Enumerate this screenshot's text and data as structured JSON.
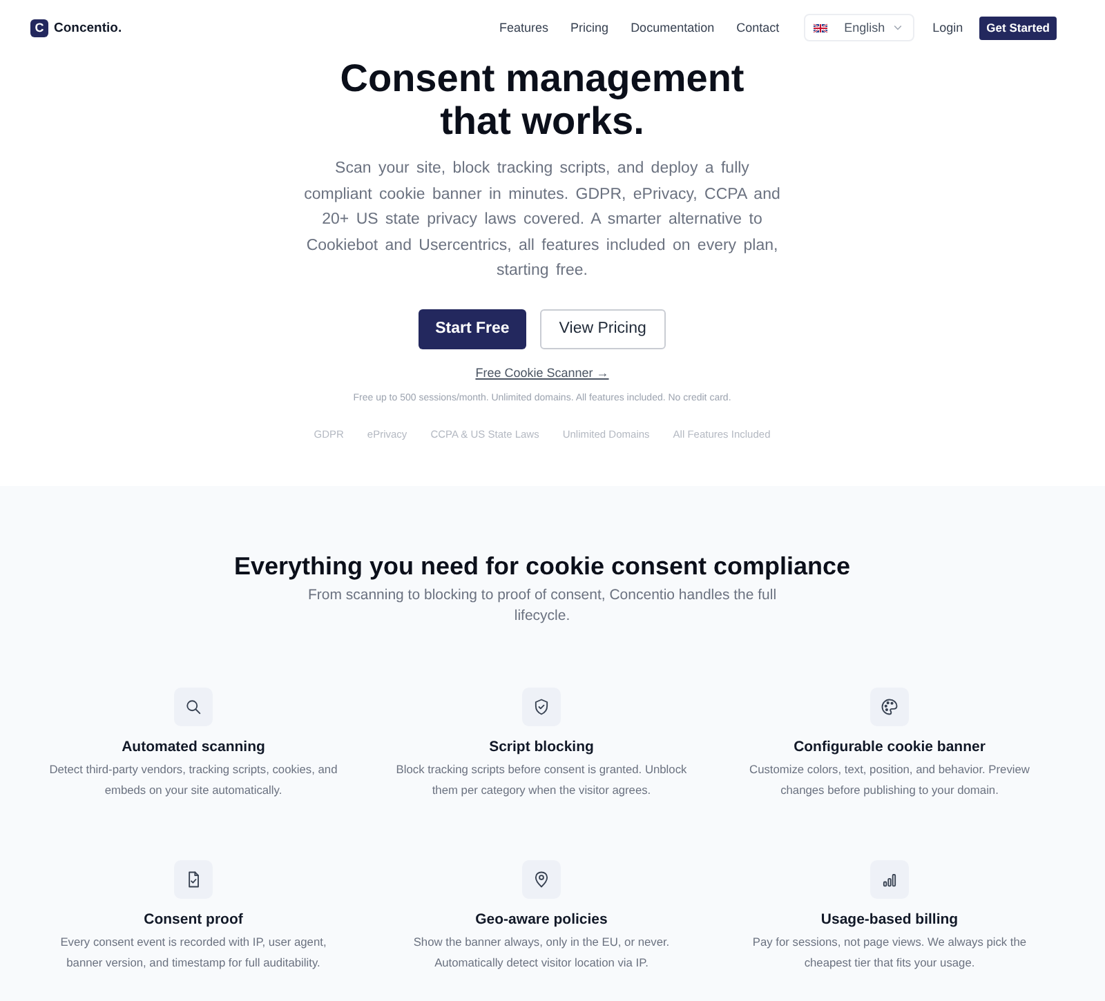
{
  "nav": {
    "logo_mark": "C",
    "brand": "Concentio.",
    "links": [
      "Features",
      "Pricing",
      "Documentation",
      "Contact"
    ],
    "language": {
      "value": "English"
    },
    "login": "Login",
    "cta": "Get Started"
  },
  "hero": {
    "title": "Consent management that works.",
    "description": "Scan your site, block tracking scripts, and deploy a fully compliant cookie banner in minutes. GDPR, ePrivacy, CCPA and 20+ US state privacy laws covered. A smarter alternative to Cookiebot and Usercentrics, all features included on every plan, starting free.",
    "buttons": [
      {
        "label": "Start Free",
        "kind": "primary"
      },
      {
        "label": "View Pricing",
        "kind": "secondary"
      }
    ],
    "scanner_link": "Free Cookie Scanner →",
    "note": "Free up to 500 sessions/month. Unlimited domains. All features included. No credit card.",
    "badges": [
      "GDPR",
      "ePrivacy",
      "CCPA & US State Laws",
      "Unlimited Domains",
      "All Features Included"
    ]
  },
  "features": {
    "title": "Everything you need for cookie consent compliance",
    "subtitle": "From scanning to blocking to proof of consent, Concentio handles the full lifecycle.",
    "items": [
      {
        "title": "Automated scanning",
        "description": "Detect third-party vendors, tracking scripts, cookies, and embeds on your site automatically."
      },
      {
        "title": "Script blocking",
        "description": "Block tracking scripts before consent is granted. Unblock them per category when the visitor agrees."
      },
      {
        "title": "Configurable cookie banner",
        "description": "Customize colors, text, position, and behavior. Preview changes before publishing to your domain."
      },
      {
        "title": "Consent proof",
        "description": "Every consent event is recorded with IP, user agent, banner version, and timestamp for full auditability."
      },
      {
        "title": "Geo-aware policies",
        "description": "Show the banner always, only in the EU, or never. Automatically detect visitor location via IP."
      },
      {
        "title": "Usage-based billing",
        "description": "Pay for sessions, not page views. We always pick the cheapest tier that fits your usage."
      }
    ]
  }
}
